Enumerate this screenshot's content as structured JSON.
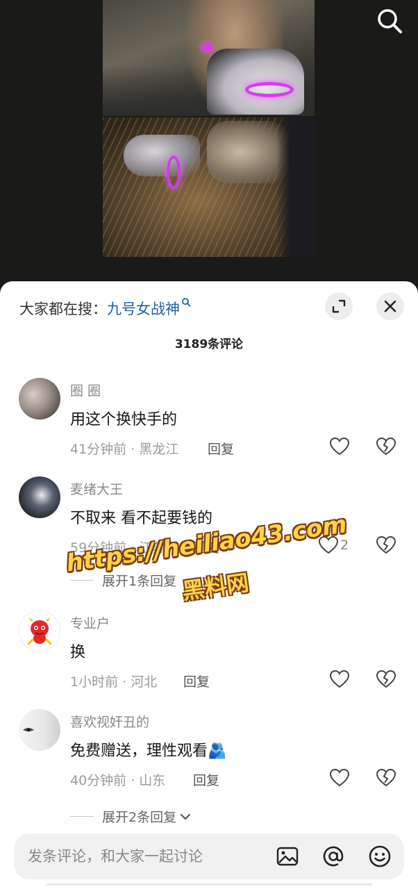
{
  "video": {
    "search_icon": "search-icon"
  },
  "sheet": {
    "hot_search_label": "大家都在搜：",
    "hot_search_keyword": "九号女战神",
    "comment_count_title": "3189条评论",
    "expand_icon": "expand-icon",
    "close_icon": "close-icon"
  },
  "comments": [
    {
      "username": "圈 圈",
      "text": "用这个换快手的",
      "meta": "41分钟前 · 黑龙江",
      "reply_label": "回复",
      "like_count": ""
    },
    {
      "username": "麦绪大王",
      "text": "不取来 看不起要钱的",
      "meta": "59分钟前 · 江苏",
      "reply_label": "回复",
      "like_count": "2",
      "expand_replies": "展开1条回复"
    },
    {
      "username": "专业户",
      "text": "换",
      "meta": "1小时前 · 河北",
      "reply_label": "回复",
      "like_count": ""
    },
    {
      "username": "喜欢视奸丑的",
      "text": "免费赠送，理性观看",
      "text_emoji": "🫂",
      "meta": "40分钟前 · 山东",
      "reply_label": "回复",
      "like_count": "",
      "expand_replies": "展开2条回复"
    }
  ],
  "watermark": {
    "url": "https://heiliao43.com",
    "name": "黑料网"
  },
  "input_bar": {
    "placeholder": "发条评论，和大家一起讨论",
    "icons": [
      "image-icon",
      "at-icon",
      "emoji-icon"
    ]
  },
  "colors": {
    "keyword": "#1f5fa8",
    "watermark_fill": "#ffd24a",
    "watermark_stroke": "#7a3a0a",
    "glow": "#d63cf0"
  }
}
